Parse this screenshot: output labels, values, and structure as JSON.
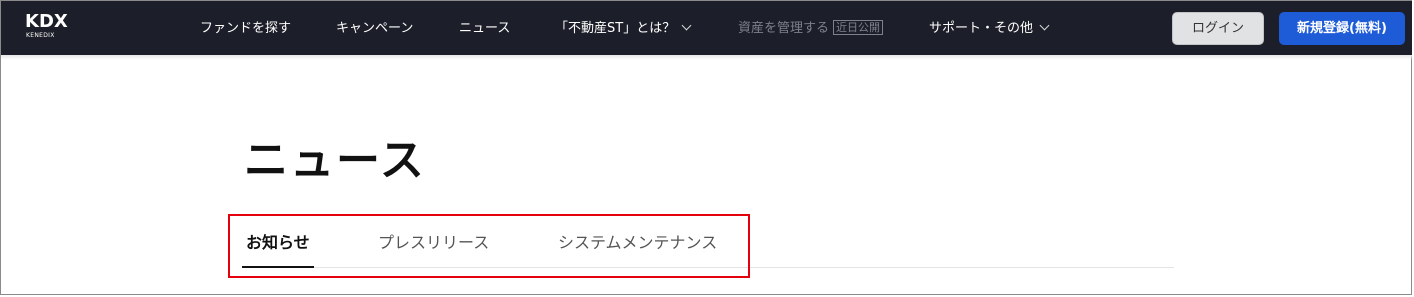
{
  "header": {
    "logo": {
      "main": "KDX",
      "sub": "KENEDIX"
    },
    "nav": [
      {
        "label": "ファンドを探す"
      },
      {
        "label": "キャンペーン"
      },
      {
        "label": "ニュース"
      },
      {
        "label": "「不動産ST」とは？",
        "has_dropdown": true
      },
      {
        "label": "資産を管理する",
        "badge": "近日公開",
        "disabled": true
      },
      {
        "label": "サポート・その他",
        "has_dropdown": true
      }
    ],
    "login_label": "ログイン",
    "register_label": "新規登録(無料)"
  },
  "main": {
    "title": "ニュース",
    "tabs": [
      {
        "label": "お知らせ",
        "active": true
      },
      {
        "label": "プレスリリース",
        "active": false
      },
      {
        "label": "システムメンテナンス",
        "active": false
      }
    ]
  },
  "colors": {
    "header_bg": "#1c1f29",
    "primary_button": "#1e5bd7",
    "highlight_border": "#e5000e"
  }
}
